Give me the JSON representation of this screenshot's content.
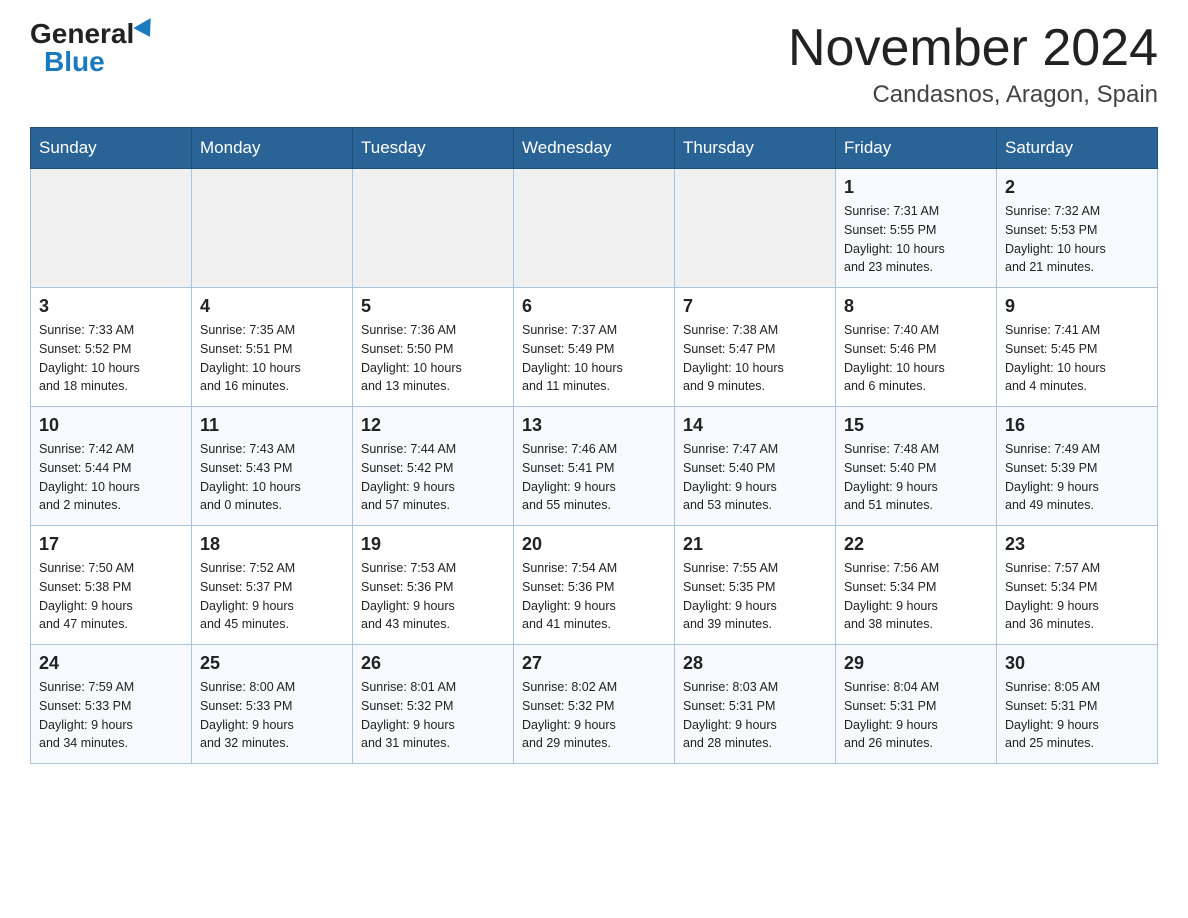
{
  "header": {
    "logo_general": "General",
    "logo_blue": "Blue",
    "month_title": "November 2024",
    "location": "Candasnos, Aragon, Spain"
  },
  "days_of_week": [
    "Sunday",
    "Monday",
    "Tuesday",
    "Wednesday",
    "Thursday",
    "Friday",
    "Saturday"
  ],
  "weeks": [
    [
      {
        "day": "",
        "info": ""
      },
      {
        "day": "",
        "info": ""
      },
      {
        "day": "",
        "info": ""
      },
      {
        "day": "",
        "info": ""
      },
      {
        "day": "",
        "info": ""
      },
      {
        "day": "1",
        "info": "Sunrise: 7:31 AM\nSunset: 5:55 PM\nDaylight: 10 hours\nand 23 minutes."
      },
      {
        "day": "2",
        "info": "Sunrise: 7:32 AM\nSunset: 5:53 PM\nDaylight: 10 hours\nand 21 minutes."
      }
    ],
    [
      {
        "day": "3",
        "info": "Sunrise: 7:33 AM\nSunset: 5:52 PM\nDaylight: 10 hours\nand 18 minutes."
      },
      {
        "day": "4",
        "info": "Sunrise: 7:35 AM\nSunset: 5:51 PM\nDaylight: 10 hours\nand 16 minutes."
      },
      {
        "day": "5",
        "info": "Sunrise: 7:36 AM\nSunset: 5:50 PM\nDaylight: 10 hours\nand 13 minutes."
      },
      {
        "day": "6",
        "info": "Sunrise: 7:37 AM\nSunset: 5:49 PM\nDaylight: 10 hours\nand 11 minutes."
      },
      {
        "day": "7",
        "info": "Sunrise: 7:38 AM\nSunset: 5:47 PM\nDaylight: 10 hours\nand 9 minutes."
      },
      {
        "day": "8",
        "info": "Sunrise: 7:40 AM\nSunset: 5:46 PM\nDaylight: 10 hours\nand 6 minutes."
      },
      {
        "day": "9",
        "info": "Sunrise: 7:41 AM\nSunset: 5:45 PM\nDaylight: 10 hours\nand 4 minutes."
      }
    ],
    [
      {
        "day": "10",
        "info": "Sunrise: 7:42 AM\nSunset: 5:44 PM\nDaylight: 10 hours\nand 2 minutes."
      },
      {
        "day": "11",
        "info": "Sunrise: 7:43 AM\nSunset: 5:43 PM\nDaylight: 10 hours\nand 0 minutes."
      },
      {
        "day": "12",
        "info": "Sunrise: 7:44 AM\nSunset: 5:42 PM\nDaylight: 9 hours\nand 57 minutes."
      },
      {
        "day": "13",
        "info": "Sunrise: 7:46 AM\nSunset: 5:41 PM\nDaylight: 9 hours\nand 55 minutes."
      },
      {
        "day": "14",
        "info": "Sunrise: 7:47 AM\nSunset: 5:40 PM\nDaylight: 9 hours\nand 53 minutes."
      },
      {
        "day": "15",
        "info": "Sunrise: 7:48 AM\nSunset: 5:40 PM\nDaylight: 9 hours\nand 51 minutes."
      },
      {
        "day": "16",
        "info": "Sunrise: 7:49 AM\nSunset: 5:39 PM\nDaylight: 9 hours\nand 49 minutes."
      }
    ],
    [
      {
        "day": "17",
        "info": "Sunrise: 7:50 AM\nSunset: 5:38 PM\nDaylight: 9 hours\nand 47 minutes."
      },
      {
        "day": "18",
        "info": "Sunrise: 7:52 AM\nSunset: 5:37 PM\nDaylight: 9 hours\nand 45 minutes."
      },
      {
        "day": "19",
        "info": "Sunrise: 7:53 AM\nSunset: 5:36 PM\nDaylight: 9 hours\nand 43 minutes."
      },
      {
        "day": "20",
        "info": "Sunrise: 7:54 AM\nSunset: 5:36 PM\nDaylight: 9 hours\nand 41 minutes."
      },
      {
        "day": "21",
        "info": "Sunrise: 7:55 AM\nSunset: 5:35 PM\nDaylight: 9 hours\nand 39 minutes."
      },
      {
        "day": "22",
        "info": "Sunrise: 7:56 AM\nSunset: 5:34 PM\nDaylight: 9 hours\nand 38 minutes."
      },
      {
        "day": "23",
        "info": "Sunrise: 7:57 AM\nSunset: 5:34 PM\nDaylight: 9 hours\nand 36 minutes."
      }
    ],
    [
      {
        "day": "24",
        "info": "Sunrise: 7:59 AM\nSunset: 5:33 PM\nDaylight: 9 hours\nand 34 minutes."
      },
      {
        "day": "25",
        "info": "Sunrise: 8:00 AM\nSunset: 5:33 PM\nDaylight: 9 hours\nand 32 minutes."
      },
      {
        "day": "26",
        "info": "Sunrise: 8:01 AM\nSunset: 5:32 PM\nDaylight: 9 hours\nand 31 minutes."
      },
      {
        "day": "27",
        "info": "Sunrise: 8:02 AM\nSunset: 5:32 PM\nDaylight: 9 hours\nand 29 minutes."
      },
      {
        "day": "28",
        "info": "Sunrise: 8:03 AM\nSunset: 5:31 PM\nDaylight: 9 hours\nand 28 minutes."
      },
      {
        "day": "29",
        "info": "Sunrise: 8:04 AM\nSunset: 5:31 PM\nDaylight: 9 hours\nand 26 minutes."
      },
      {
        "day": "30",
        "info": "Sunrise: 8:05 AM\nSunset: 5:31 PM\nDaylight: 9 hours\nand 25 minutes."
      }
    ]
  ]
}
